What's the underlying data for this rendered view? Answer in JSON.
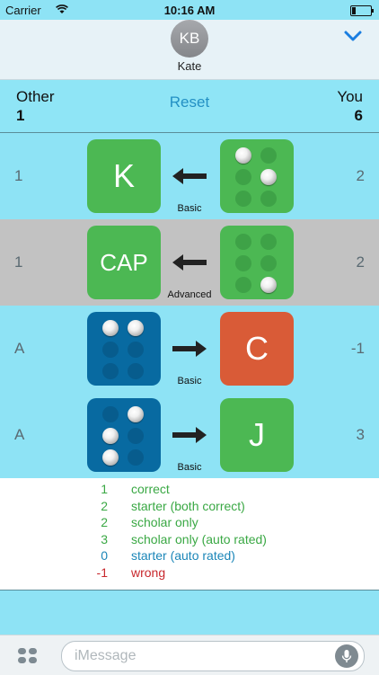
{
  "status": {
    "carrier": "Carrier",
    "time": "10:16 AM",
    "battery_level": 0.2
  },
  "header": {
    "avatar_initials": "KB",
    "contact_name": "Kate"
  },
  "scorebar": {
    "other_label": "Other",
    "other_score": "1",
    "reset_label": "Reset",
    "you_label": "You",
    "you_score": "6"
  },
  "rows": [
    {
      "left": "1",
      "right": "2",
      "label": "Basic",
      "arrow": "left",
      "tile1": {
        "color": "green",
        "text": "K"
      },
      "tile2": {
        "color": "green",
        "dots": [
          1,
          0,
          0,
          0,
          1,
          0
        ]
      }
    },
    {
      "left": "1",
      "right": "2",
      "label": "Advanced",
      "arrow": "left",
      "tile1": {
        "color": "green",
        "text": "CAP"
      },
      "tile2": {
        "color": "green",
        "dots": [
          0,
          0,
          0,
          0,
          0,
          1
        ]
      }
    },
    {
      "left": "A",
      "right": "-1",
      "label": "Basic",
      "arrow": "right",
      "tile1": {
        "color": "blue",
        "dots": [
          1,
          0,
          0,
          1,
          0,
          0
        ]
      },
      "tile2": {
        "color": "orange",
        "text": "C"
      }
    },
    {
      "left": "A",
      "right": "3",
      "label": "Basic",
      "arrow": "right",
      "tile1": {
        "color": "blue",
        "dots": [
          0,
          1,
          1,
          1,
          0,
          0
        ]
      },
      "tile2": {
        "color": "green",
        "text": "J"
      }
    }
  ],
  "legend": [
    {
      "value": "1",
      "text": "correct",
      "color": "#3aa844"
    },
    {
      "value": "2",
      "text": "starter (both correct)",
      "color": "#3aa844"
    },
    {
      "value": "2",
      "text": "scholar only",
      "color": "#3aa844"
    },
    {
      "value": "3",
      "text": "scholar only (auto rated)",
      "color": "#3aa844"
    },
    {
      "value": "0",
      "text": "starter (auto rated)",
      "color": "#1b86b8"
    },
    {
      "value": "-1",
      "text": "wrong",
      "color": "#c8282d"
    }
  ],
  "input": {
    "placeholder": "iMessage"
  },
  "icons": {
    "wifi": "wifi-icon",
    "battery": "battery-icon",
    "chevron": "chevron-down-icon",
    "apps": "app-drawer-icon",
    "mic": "microphone-icon"
  },
  "colors": {
    "green": "#4cb853",
    "blue": "#086aa1",
    "orange": "#d95b37",
    "row_bg": "#8ee3f5",
    "row_selected_bg": "#c2c2c2"
  }
}
